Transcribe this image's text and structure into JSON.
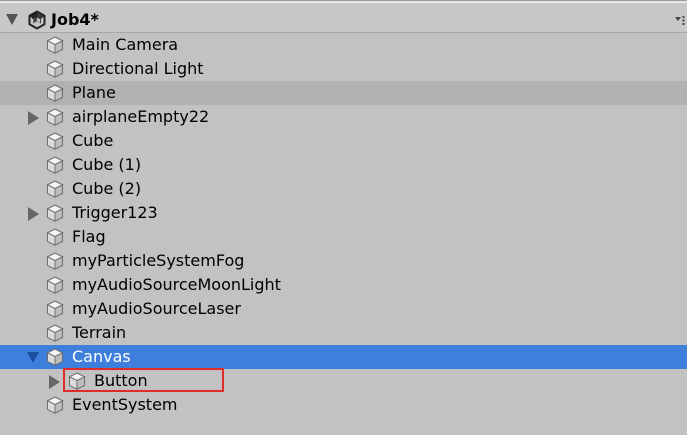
{
  "scene": {
    "title": "Job4*"
  },
  "items": [
    {
      "label": "Main Camera"
    },
    {
      "label": "Directional Light"
    },
    {
      "label": "Plane"
    },
    {
      "label": "airplaneEmpty22"
    },
    {
      "label": "Cube"
    },
    {
      "label": "Cube (1)"
    },
    {
      "label": "Cube (2)"
    },
    {
      "label": "Trigger123"
    },
    {
      "label": "Flag"
    },
    {
      "label": "myParticleSystemFog"
    },
    {
      "label": "myAudioSourceMoonLight"
    },
    {
      "label": "myAudioSourceLaser"
    },
    {
      "label": "Terrain"
    },
    {
      "label": "Canvas"
    },
    {
      "label": "Button"
    },
    {
      "label": "EventSystem"
    }
  ],
  "colors": {
    "panel_bg": "#c2c2c2",
    "hover_bg": "#b1b1b1",
    "selected_bg": "#3f7fdc",
    "highlight_border": "#e02b2b"
  },
  "icons": {
    "scene": "unity-logo-icon",
    "gameobject": "cube-icon",
    "menu": "dropdown-menu-icon"
  }
}
